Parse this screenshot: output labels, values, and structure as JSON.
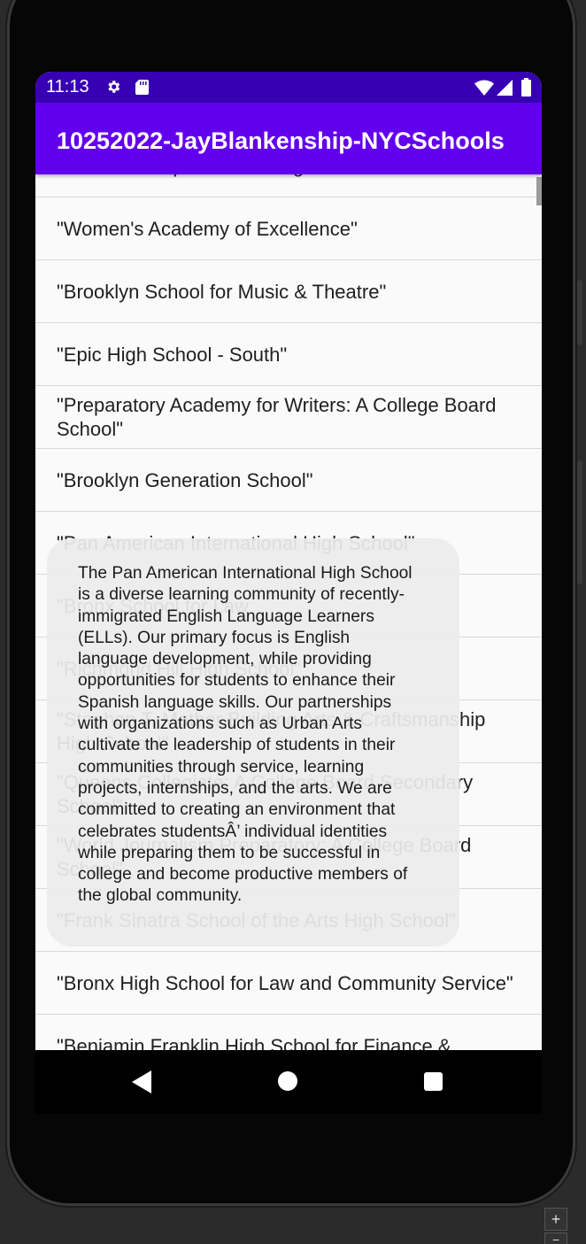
{
  "status_bar": {
    "time": "11:13",
    "icons": [
      "gear-icon",
      "sd-card-icon",
      "wifi-icon",
      "signal-icon",
      "battery-icon"
    ]
  },
  "app_bar": {
    "title": "10252022-JayBlankenship-NYCSchools",
    "background": "#6200ee",
    "status_background": "#3700b3"
  },
  "schools": [
    "\"Liberation Diploma Plus High School\"",
    "\"Women's Academy of Excellence\"",
    "\"Brooklyn School for Music & Theatre\"",
    "\"Epic High School - South\"",
    "\"Preparatory Academy for Writers: A College Board School\"",
    "\"Brooklyn Generation School\"",
    "\"Pan American International High School\"",
    "\"Bronx School for Law",
    "\"Richmond Hill High School\"",
    "\"Stephen T. Mather Building Arts & Craftsmanship High School\"",
    "\"Queens Collegiate: A College Board Secondary School\"",
    "\"World Journalism Preparatory: A College Board School\"",
    "\"Frank Sinatra School of the Arts High School\"",
    "\"Bronx High School for Law and Community Service\"",
    "\"Benjamin Franklin High School for Finance &"
  ],
  "toast": {
    "text": "The Pan American International High School is a diverse learning community of recently-immigrated English Language Learners (ELLs). Our primary focus is English language development, while providing opportunities for students to enhance their Spanish language skills. Our partnerships with organizations such as Urban Arts cultivate the leadership of students in their communities through service, learning projects, internships, and the arts. We are committed to creating an environment that celebrates studentsÂ’ individual identities while preparing them to be successful in college and become productive members of the global community."
  },
  "nav_bar": {
    "icons": [
      "back-icon",
      "home-icon",
      "recents-icon"
    ]
  },
  "emulator": {
    "zoom_in": "+",
    "zoom_out": "−"
  }
}
